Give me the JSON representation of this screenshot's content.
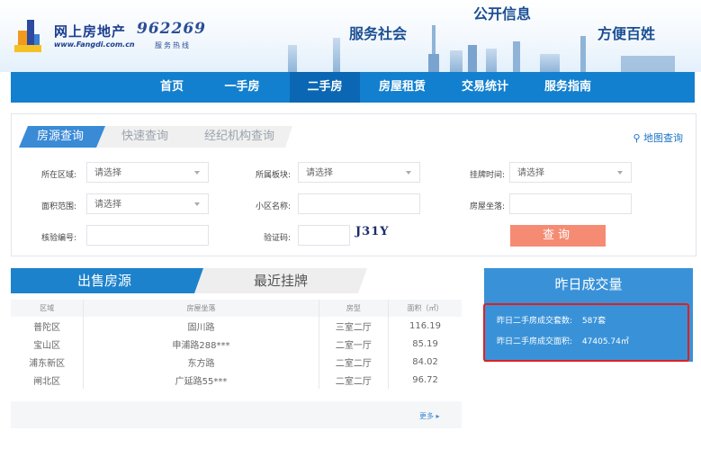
{
  "header": {
    "logo_cn": "网上房地产",
    "logo_en": "www.Fangdi.com.cn",
    "hotline": "962269",
    "hotline_sub": "服务热线",
    "slogans": [
      "服务社会",
      "公开信息",
      "方便百姓"
    ]
  },
  "nav": {
    "items": [
      "首页",
      "一手房",
      "二手房",
      "房屋租赁",
      "交易统计",
      "服务指南"
    ],
    "active": "二手房"
  },
  "search": {
    "tabs": [
      "房源查询",
      "快速查询",
      "经纪机构查询"
    ],
    "map_link": "地图查询",
    "fields": {
      "district_label": "所在区域:",
      "district_value": "请选择",
      "block_label": "所属板块:",
      "block_value": "请选择",
      "listing_time_label": "挂牌时间:",
      "listing_time_value": "请选择",
      "area_label": "面积范围:",
      "area_value": "请选择",
      "community_label": "小区名称:",
      "community_value": "",
      "location_label": "房屋坐落:",
      "location_value": "",
      "verify_no_label": "核验编号:",
      "verify_no_value": "",
      "captcha_label": "验证码:",
      "captcha_value": "",
      "captcha_image_text": "J31Y"
    },
    "query_button": "查询"
  },
  "listing": {
    "tabs": [
      "出售房源",
      "最近挂牌"
    ],
    "columns": [
      "区域",
      "房屋坐落",
      "房型",
      "面积（㎡）"
    ],
    "rows": [
      [
        "普陀区",
        "固川路",
        "三室二厅",
        "116.19"
      ],
      [
        "宝山区",
        "申浦路288***",
        "二室一厅",
        "85.19"
      ],
      [
        "浦东新区",
        "东方路",
        "二室二厅",
        "84.02"
      ],
      [
        "闸北区",
        "广延路55***",
        "二室二厅",
        "96.72"
      ]
    ],
    "more": "更多 ▸"
  },
  "yesterday": {
    "title": "昨日成交量",
    "count_label": "昨日二手房成交套数:",
    "count_value": "587套",
    "area_label": "昨日二手房成交面积:",
    "area_value": "47405.74㎡"
  },
  "colors": {
    "nav_blue": "#1380cf",
    "accent_red": "#e02020",
    "query_btn": "#f58b73"
  }
}
